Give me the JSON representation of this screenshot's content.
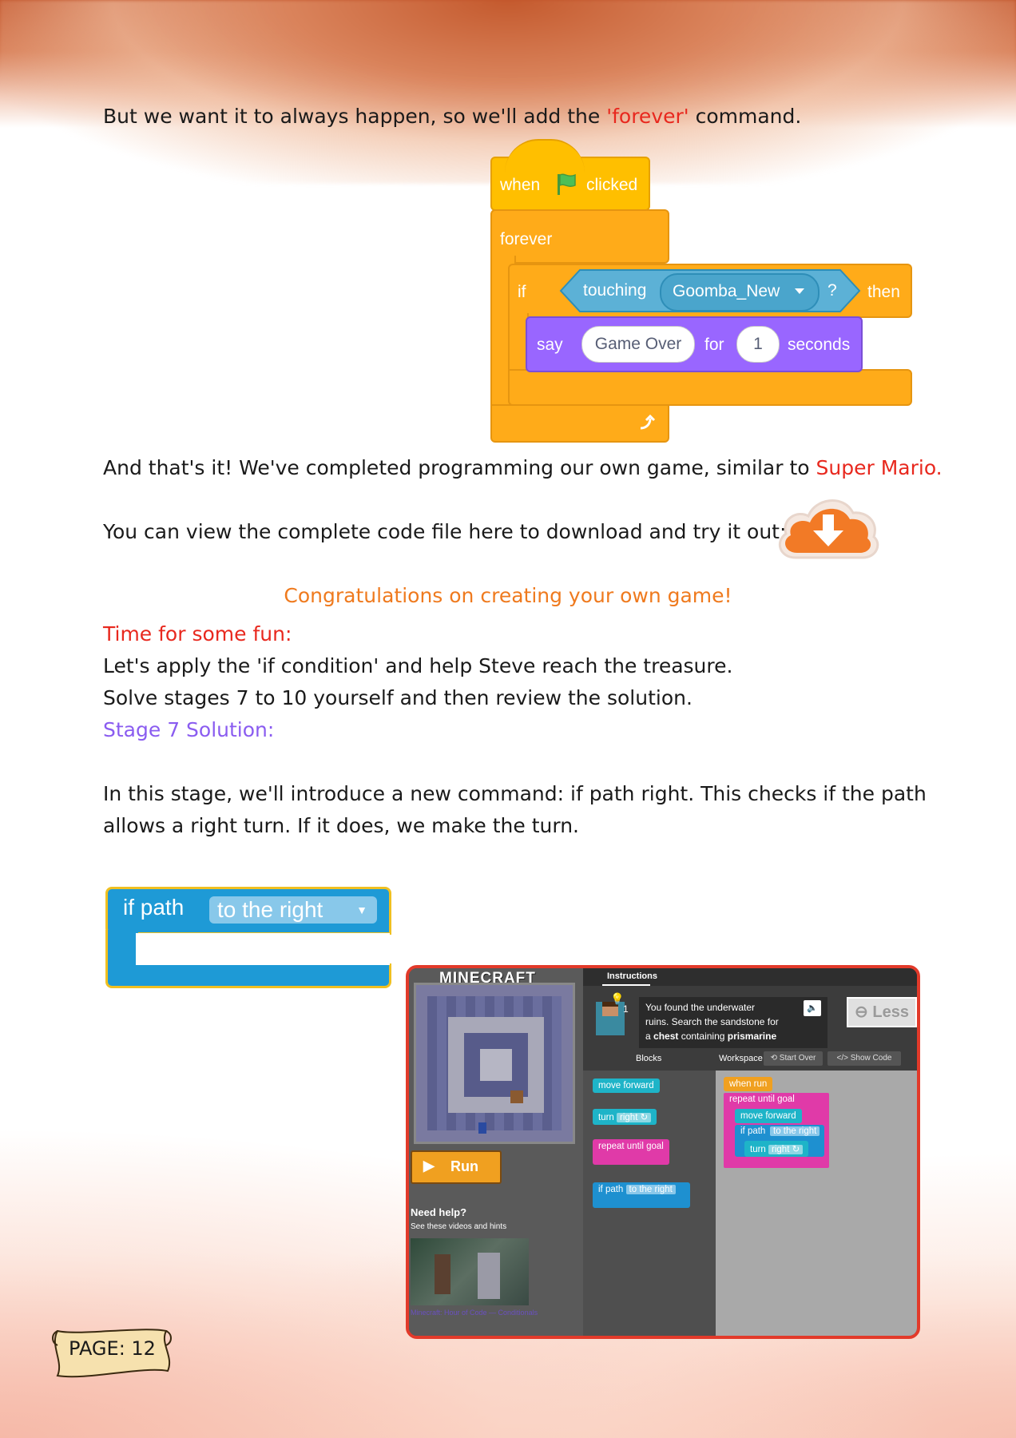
{
  "page": {
    "line1": {
      "pre": "But we want it to always happen, so we'll add the ",
      "highlight": "'forever'",
      "post": " command."
    },
    "line2": {
      "pre": "And that's it! We've completed programming our own game, similar to ",
      "highlight": "Super Mario."
    },
    "line3": "You can view the complete code file here to download and try it out:",
    "congrats": "Congratulations on creating your own game!",
    "fun_heading": "Time for some fun:",
    "fun_line1": "Let's apply the 'if condition' and help Steve reach the treasure.",
    "fun_line2": "Solve stages 7 to 10 yourself and then review the solution.",
    "stage_heading": "Stage 7 Solution:",
    "para1": "In this stage, we'll introduce a new command: if path right. This checks if the path",
    "para2": "allows a right turn. If it does, we make the turn.",
    "page_label": "PAGE: 12"
  },
  "scratch": {
    "when": "when",
    "clicked": "clicked",
    "forever": "forever",
    "if": "if",
    "touching": "touching",
    "sprite": "Goomba_New",
    "question": "?",
    "then": "then",
    "say": "say",
    "message": "Game Over",
    "for": "for",
    "secs_value": "1",
    "seconds": "seconds"
  },
  "if_path_block": {
    "label": "if path",
    "dropdown": "to the right"
  },
  "minecraft": {
    "logo": "MINECRAFT",
    "instructions_tab": "Instructions",
    "instruction_l1": "You found the underwater",
    "instruction_l2": "ruins. Search the sandstone for",
    "instruction_l3a": "a ",
    "instruction_l3b": "chest",
    "instruction_l3c": " containing ",
    "instruction_l3d": "prismarine",
    "hint_count": "1",
    "less_button": "Less",
    "blocks_header": "Blocks",
    "workspace_header": "Workspace",
    "start_over": "Start Over",
    "show_code": "Show Code",
    "run_button": "Run",
    "need_help": "Need help?",
    "see_videos": "See these videos and hints",
    "video_caption": "Minecraft: Hour of Code — Conditionals",
    "toolbox": {
      "move_forward": "move forward",
      "turn": "turn",
      "turn_dir": "right ↻",
      "repeat": "repeat until goal",
      "if_path": "if path",
      "if_dir": "to the right"
    },
    "workspace": {
      "when_run": "when run",
      "repeat": "repeat until goal",
      "move_forward": "move forward",
      "if_path": "if path",
      "if_dir": "to the right",
      "turn": "turn",
      "turn_dir": "right ↻"
    }
  },
  "colors": {
    "red": "#e8281e",
    "orange": "#ef7a1e",
    "purple": "#8a5cf0",
    "scratch_control": "#ffab19",
    "scratch_looks": "#9966ff",
    "scratch_sensing": "#5cb1d6",
    "download_cloud": "#f27a26"
  },
  "icons": [
    "green-flag-icon",
    "dropdown-arrow-icon",
    "loop-arrow-icon",
    "download-cloud-icon",
    "scroll-icon"
  ]
}
